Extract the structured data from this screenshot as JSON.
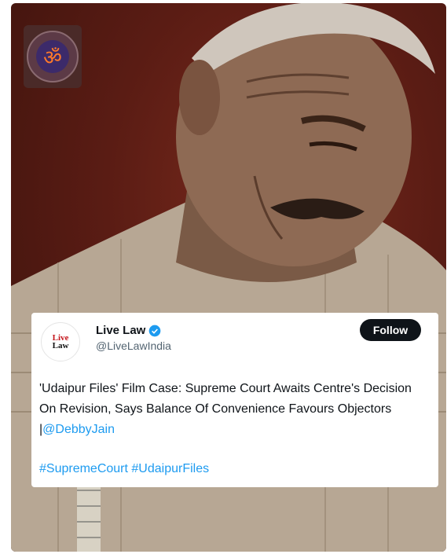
{
  "watermark": {
    "icon": "om-icon",
    "accent": "#ff7a2a"
  },
  "tweet": {
    "avatar": {
      "line1": "Live",
      "line2": "Law"
    },
    "author_name": "Live Law",
    "handle": "@LiveLawIndia",
    "follow_label": "Follow",
    "body": "'Udaipur Files' Film Case: Supreme Court Awaits Centre's Decision On Revision, Says Balance Of Convenience Favours Objectors |",
    "mention": "@DebbyJain",
    "hashtags": [
      "#SupremeCourt",
      "#UdaipurFiles"
    ]
  },
  "colors": {
    "link": "#1d9bf0",
    "follow_bg": "#0f1419",
    "verified": "#1d9bf0",
    "brand_red": "#c4161c"
  }
}
